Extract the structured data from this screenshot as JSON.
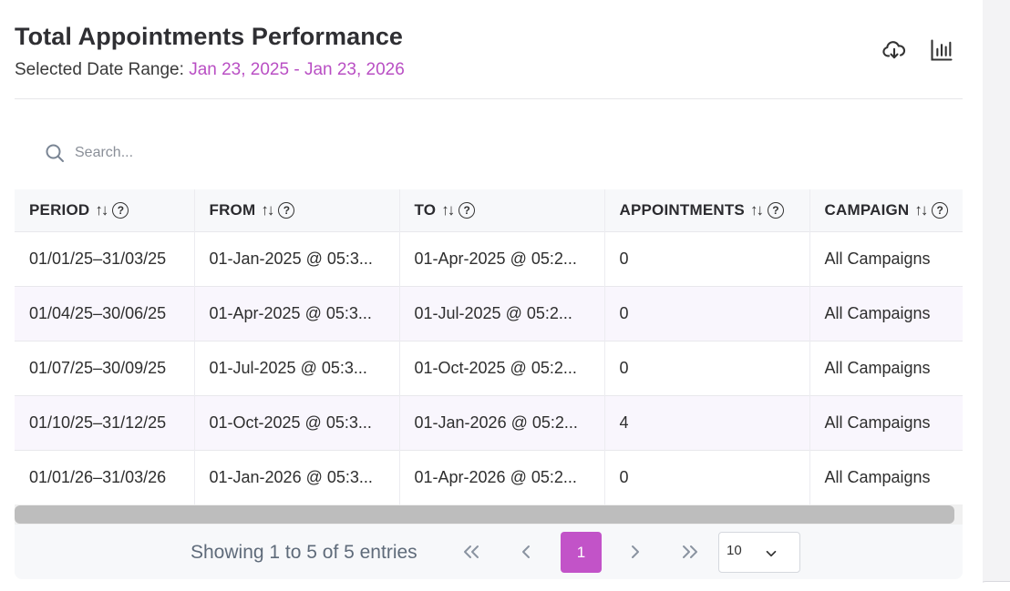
{
  "header": {
    "title": "Total Appointments Performance",
    "date_label": "Selected Date Range:",
    "date_range": "Jan 23, 2025 - Jan 23, 2026",
    "icons": [
      "cloud-download-icon",
      "bar-chart-icon"
    ]
  },
  "search": {
    "placeholder": "Search..."
  },
  "table": {
    "columns": [
      {
        "label": "PERIOD"
      },
      {
        "label": "FROM"
      },
      {
        "label": "TO"
      },
      {
        "label": "APPOINTMENTS"
      },
      {
        "label": "CAMPAIGN"
      }
    ],
    "sort_glyph": "↑↓",
    "help_glyph": "?",
    "rows": [
      [
        "01/01/25–31/03/25",
        "01-Jan-2025 @ 05:3...",
        "01-Apr-2025 @ 05:2...",
        "0",
        "All Campaigns"
      ],
      [
        "01/04/25–30/06/25",
        "01-Apr-2025 @ 05:3...",
        "01-Jul-2025 @ 05:2...",
        "0",
        "All Campaigns"
      ],
      [
        "01/07/25–30/09/25",
        "01-Jul-2025 @ 05:3...",
        "01-Oct-2025 @ 05:2...",
        "0",
        "All Campaigns"
      ],
      [
        "01/10/25–31/12/25",
        "01-Oct-2025 @ 05:3...",
        "01-Jan-2026 @ 05:2...",
        "4",
        "All Campaigns"
      ],
      [
        "01/01/26–31/03/26",
        "01-Jan-2026 @ 05:3...",
        "01-Apr-2026 @ 05:2...",
        "0",
        "All Campaigns"
      ]
    ]
  },
  "pagination": {
    "showing_text": "Showing 1 to 5 of 5 entries",
    "current_page": "1",
    "page_size": "10",
    "accent_color": "#c253c8"
  }
}
